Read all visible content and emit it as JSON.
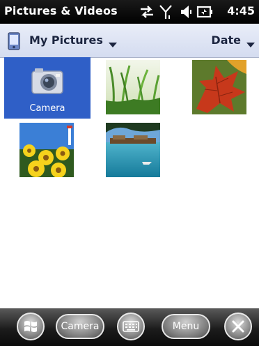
{
  "statusbar": {
    "title": "Pictures & Videos",
    "time": "4:45",
    "icons": [
      "data-sync-icon",
      "signal-icon",
      "volume-icon",
      "battery-icon"
    ]
  },
  "folderbar": {
    "folder_label": "My Pictures",
    "folder_icon": "pda-device-icon",
    "sort_label": "Date"
  },
  "grid": {
    "camera_label": "Camera",
    "items": [
      {
        "name": "camera",
        "label": "Camera",
        "selected": true
      },
      {
        "name": "grass-photo"
      },
      {
        "name": "autumn-leaf-photo"
      },
      {
        "name": "yellow-flowers-photo"
      },
      {
        "name": "beach-resort-photo"
      }
    ]
  },
  "softkeys": {
    "left_label": "Camera",
    "right_label": "Menu",
    "icons": [
      "windows-start-icon",
      "keyboard-icon",
      "close-icon"
    ]
  },
  "colors": {
    "selection": "#2f5fc7",
    "titlebar": "#000000",
    "folderbar": "#dde3f4"
  }
}
